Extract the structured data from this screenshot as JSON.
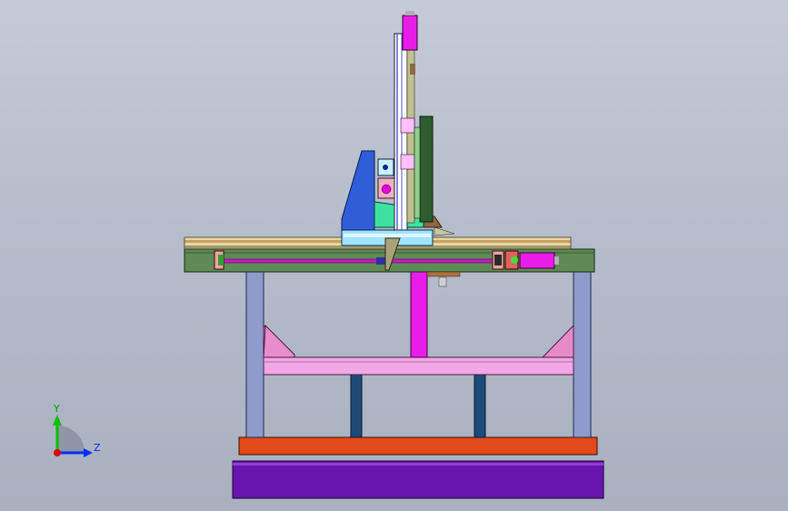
{
  "triad": {
    "y_label": "Y",
    "z_label": "Z",
    "colors": {
      "y": "#00c000",
      "z": "#0030ff",
      "origin": "#e00000"
    }
  },
  "colors": {
    "background": "#b9bfcd",
    "base_purple": "#6a14b0",
    "plate_orange": "#e24a1a",
    "crossbeam_pink": "#f2a8e6",
    "gusset_pink": "#e78bc8",
    "leg_blue": "#8e9bcc",
    "post_navy": "#1f4a78",
    "frame_olive": "#5f8a55",
    "screw_magenta": "#c818c8",
    "column_magenta": "#e81ee8",
    "bracket_blue": "#2f5ed8",
    "block_green": "#3ee2a0",
    "rail_dark_green": "#2f5d2f"
  }
}
